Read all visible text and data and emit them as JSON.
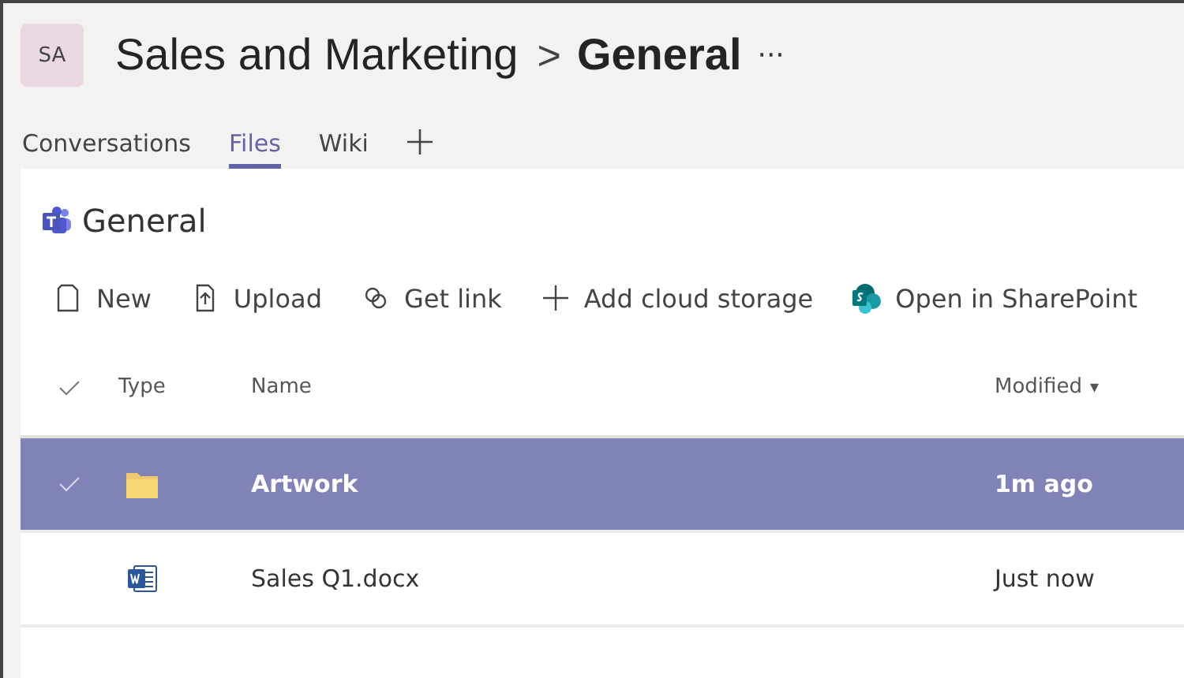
{
  "header": {
    "avatar": "SA",
    "team": "Sales and Marketing",
    "separator": ">",
    "channel": "General",
    "more": "···"
  },
  "tabs": [
    {
      "label": "Conversations",
      "selected": false
    },
    {
      "label": "Files",
      "selected": true
    },
    {
      "label": "Wiki",
      "selected": false
    }
  ],
  "library": {
    "title": "General"
  },
  "toolbar": [
    {
      "kind": "new",
      "label": "New"
    },
    {
      "kind": "upload",
      "label": "Upload"
    },
    {
      "kind": "link",
      "label": "Get link"
    },
    {
      "kind": "add",
      "label": "Add cloud storage"
    },
    {
      "kind": "sharepoint",
      "label": "Open in SharePoint"
    }
  ],
  "table": {
    "columns": [
      "Type",
      "Name",
      "Modified"
    ],
    "sort_caret": "▾",
    "rows": [
      {
        "kind": "folder",
        "name": "Artwork",
        "modified": "1m ago",
        "selected": true
      },
      {
        "kind": "word",
        "name": "Sales Q1.docx",
        "modified": "Just now",
        "selected": false
      }
    ]
  }
}
